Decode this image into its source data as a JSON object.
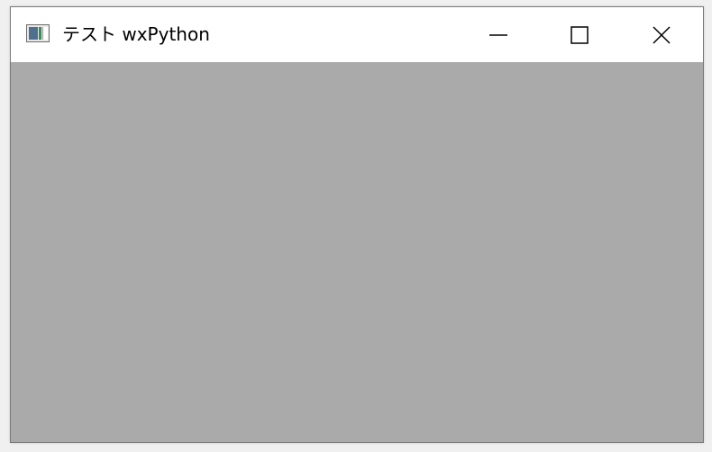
{
  "window": {
    "title": "テスト wxPython",
    "icon": "app-window-icon",
    "controls": {
      "minimize_icon": "minimize-icon",
      "maximize_icon": "maximize-icon",
      "close_icon": "close-icon"
    }
  },
  "colors": {
    "titlebar": "#ffffff",
    "client_area": "#aaaaaa",
    "border": "#7a7a7a"
  }
}
